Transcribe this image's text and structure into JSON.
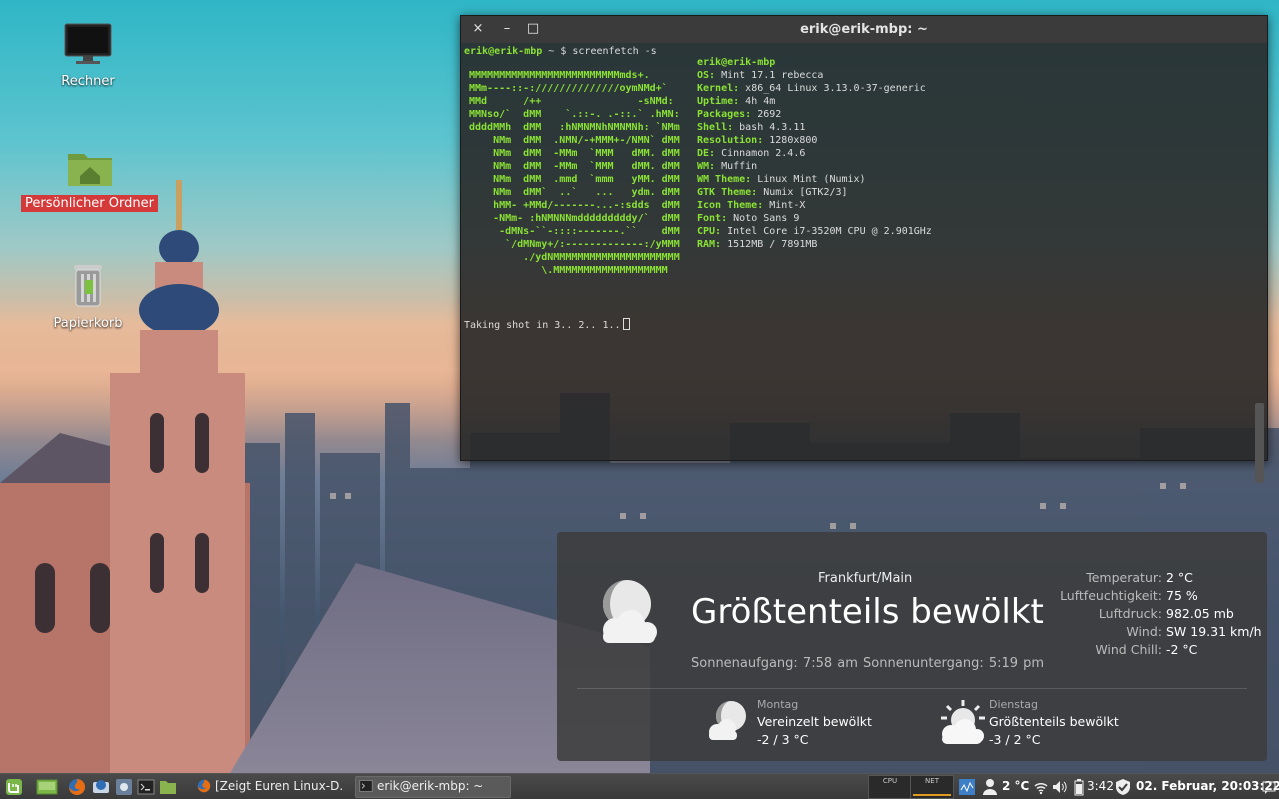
{
  "desktop": {
    "icons": [
      {
        "label": "Rechner",
        "icon": "monitor-icon"
      },
      {
        "label": "Persönlicher Ordner",
        "icon": "home-folder-icon"
      },
      {
        "label": "Papierkorb",
        "icon": "trash-icon"
      }
    ]
  },
  "terminal": {
    "title": "erik@erik-mbp: ~",
    "buttons": {
      "close": "×",
      "minimize": "–",
      "maximize": "□"
    },
    "prompt_user": "erik@erik-mbp",
    "prompt_rest": " ~ $ screenfetch -s",
    "ascii_art": "MMMMMMMMMMMMMMMMMMMMMMMMMmds+.\nMMm----::-://////////////oymNMd+`\nMMd      /++                -sNMd:\nMMNso/`  dMM    `.::-. .-::.` .hMN:\nddddMMh  dMM   :hNMNMNhNMNMNh: `NMm\n    NMm  dMM  .NMN/-+MMM+-/NMN` dMM\n    NMm  dMM  -MMm  `MMM   dMM. dMM\n    NMm  dMM  -MMm  `MMM   dMM. dMM\n    NMm  dMM  .mmd  `mmm   yMM. dMM\n    NMm  dMM`  ..`   ...   ydm. dMM\n    hMM- +MMd/-------...-:sdds  dMM\n    -NMm- :hNMNNNmdddddddddy/`  dMM\n     -dMNs-``-::::-------.``    dMM\n      `/dMNmy+/:-------------:/yMMM\n         ./ydNMMMMMMMMMMMMMMMMMMMMM\n            \\.MMMMMMMMMMMMMMMMMMM",
    "host": "erik@erik-mbp",
    "info": [
      {
        "key": "OS:",
        "value": " Mint 17.1 rebecca"
      },
      {
        "key": "Kernel:",
        "value": " x86_64 Linux 3.13.0-37-generic"
      },
      {
        "key": "Uptime:",
        "value": " 4h 4m"
      },
      {
        "key": "Packages:",
        "value": " 2692"
      },
      {
        "key": "Shell:",
        "value": " bash 4.3.11"
      },
      {
        "key": "Resolution:",
        "value": " 1280x800"
      },
      {
        "key": "DE:",
        "value": " Cinnamon 2.4.6"
      },
      {
        "key": "WM:",
        "value": " Muffin"
      },
      {
        "key": "WM Theme:",
        "value": " Linux Mint (Numix)"
      },
      {
        "key": "GTK Theme:",
        "value": " Numix [GTK2/3]"
      },
      {
        "key": "Icon Theme:",
        "value": " Mint-X"
      },
      {
        "key": "Font:",
        "value": " Noto Sans 9"
      },
      {
        "key": "CPU:",
        "value": " Intel Core i7-3520M CPU @ 2.901GHz"
      },
      {
        "key": "RAM:",
        "value": " 1512MB / 7891MB"
      }
    ],
    "shot_line": "Taking shot in 3.. 2.. 1.."
  },
  "weather": {
    "city": "Frankfurt/Main",
    "condition": "Größtenteils bewölkt",
    "sun": "Sonnenaufgang: 7:58 am   Sonnenuntergang: 5:19 pm",
    "stats": [
      {
        "key": "Temperatur:",
        "value": "2 °C"
      },
      {
        "key": "Luftfeuchtigkeit:",
        "value": "75 %"
      },
      {
        "key": "Luftdruck:",
        "value": "982.05 mb"
      },
      {
        "key": "Wind:",
        "value": "SW 19.31 km/h"
      },
      {
        "key": "Wind Chill:",
        "value": "-2 °C"
      }
    ],
    "forecast": [
      {
        "day": "Montag",
        "condition": "Vereinzelt bewölkt",
        "temp": "-2 / 3 °C",
        "icon": "partly-cloudy-night-icon"
      },
      {
        "day": "Dienstag",
        "condition": "Größtenteils bewölkt",
        "temp": "-3 / 2 °C",
        "icon": "mostly-cloudy-day-icon"
      }
    ]
  },
  "panel": {
    "tasks": [
      {
        "label": "[Zeigt Euren Linux-D...",
        "icon": "firefox-icon"
      },
      {
        "label": "erik@erik-mbp: ~",
        "icon": "terminal-icon"
      }
    ],
    "graphs": {
      "cpu": "CPU",
      "net": "NET"
    },
    "temp": "2 °C",
    "battery_time": "3:42",
    "clock": "02. Februar, 20:03:22"
  }
}
